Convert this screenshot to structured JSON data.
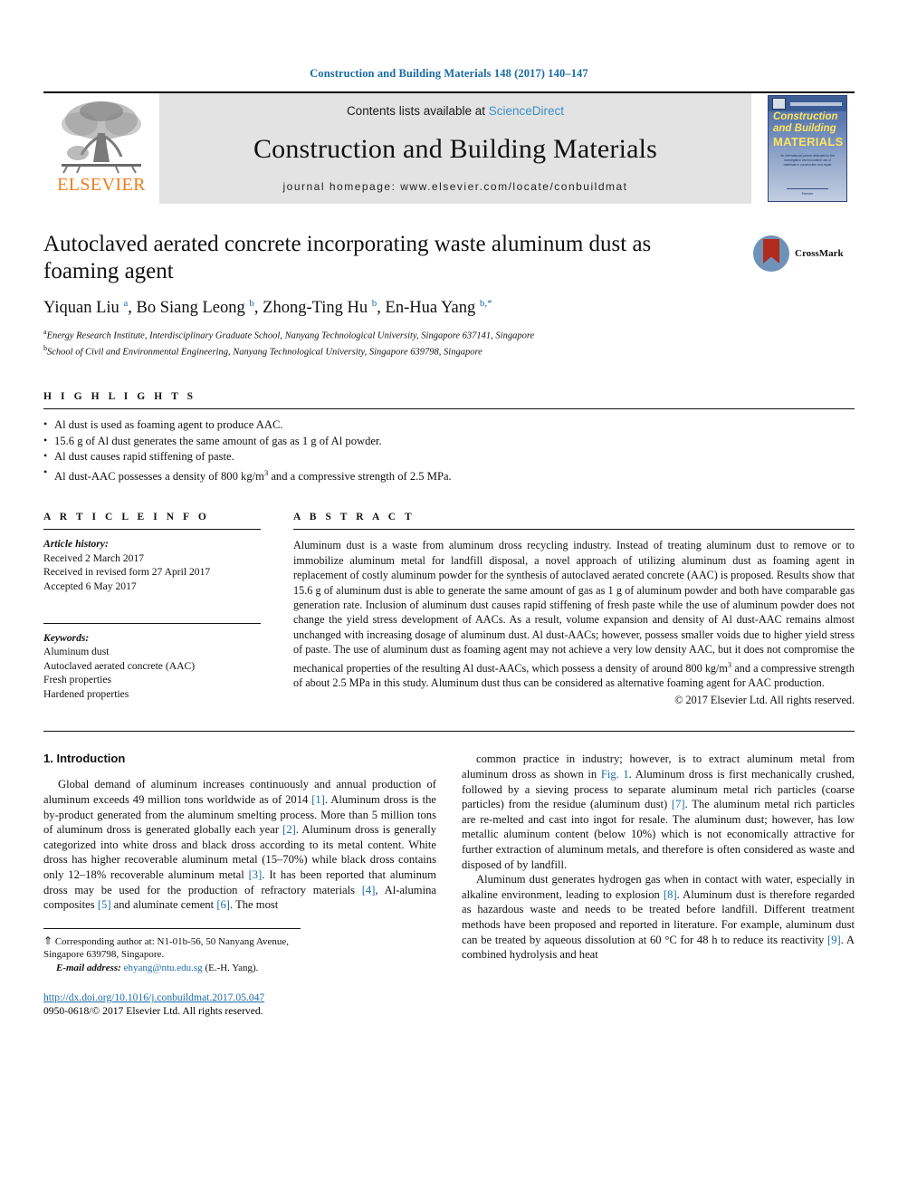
{
  "running_head": "Construction and Building Materials 148 (2017) 140–147",
  "masthead": {
    "elsevier_wordmark": "ELSEVIER",
    "contents_prefix": "Contents lists available at ",
    "contents_link": "ScienceDirect",
    "journal_title": "Construction and Building Materials",
    "homepage": "journal homepage: www.elsevier.com/locate/conbuildmat",
    "cover": {
      "line1": "Construction",
      "line2": "and Building",
      "line3": "MATERIALS",
      "blurb": "An international journal dedicated to the investigation and innovative use of materials in construction and repair",
      "footer": "Elsevier"
    }
  },
  "article": {
    "title": "Autoclaved aerated concrete incorporating waste aluminum dust as foaming agent",
    "crossmark_label": "CrossMark",
    "authors_html": "Yiquan Liu <sup>a</sup>, Bo Siang Leong <sup>b</sup>, Zhong-Ting Hu <sup>b</sup>, En-Hua Yang <sup>b,*</sup>",
    "affiliation_a": "Energy Research Institute, Interdisciplinary Graduate School, Nanyang Technological University, Singapore 637141, Singapore",
    "affiliation_b": "School of Civil and Environmental Engineering, Nanyang Technological University, Singapore 639798, Singapore"
  },
  "highlights": {
    "heading": "H I G H L I G H T S",
    "items_html": [
      "Al dust is used as foaming agent to produce AAC.",
      "15.6 g of Al dust generates the same amount of gas as 1 g of Al powder.",
      "Al dust causes rapid stiffening of paste.",
      "Al dust-AAC possesses a density of 800 kg/m<sup>3</sup> and a compressive strength of 2.5 MPa."
    ]
  },
  "article_info": {
    "heading": "A R T I C L E   I N F O",
    "history_label": "Article history:",
    "history": [
      "Received 2 March 2017",
      "Received in revised form 27 April 2017",
      "Accepted 6 May 2017"
    ],
    "keywords_label": "Keywords:",
    "keywords": [
      "Aluminum dust",
      "Autoclaved aerated concrete (AAC)",
      "Fresh properties",
      "Hardened properties"
    ]
  },
  "abstract": {
    "heading": "A B S T R A C T",
    "text_html": "Aluminum dust is a waste from aluminum dross recycling industry. Instead of treating aluminum dust to remove or to immobilize aluminum metal for landfill disposal, a novel approach of utilizing aluminum dust as foaming agent in replacement of costly aluminum powder for the synthesis of autoclaved aerated concrete (AAC) is proposed. Results show that 15.6 g of aluminum dust is able to generate the same amount of gas as 1 g of aluminum powder and both have comparable gas generation rate. Inclusion of aluminum dust causes rapid stiffening of fresh paste while the use of aluminum powder does not change the yield stress development of AACs. As a result, volume expansion and density of Al dust-AAC remains almost unchanged with increasing dosage of aluminum dust. Al dust-AACs; however, possess smaller voids due to higher yield stress of paste. The use of aluminum dust as foaming agent may not achieve a very low density AAC, but it does not compromise the mechanical properties of the resulting Al dust-AACs, which possess a density of around 800 kg/m<sup>3</sup> and a compressive strength of about 2.5 MPa in this study. Aluminum dust thus can be considered as alternative foaming agent for AAC production.",
    "copyright": "© 2017 Elsevier Ltd. All rights reserved."
  },
  "body": {
    "section_title": "1. Introduction",
    "left_paragraphs_html": [
      "Global demand of aluminum increases continuously and annual production of aluminum exceeds 49 million tons worldwide as of 2014 <span class=\"ref\">[1]</span>. Aluminum dross is the by-product generated from the aluminum smelting process. More than 5 million tons of aluminum dross is generated globally each year <span class=\"ref\">[2]</span>. Aluminum dross is generally categorized into white dross and black dross according to its metal content. White dross has higher recoverable aluminum metal (15–70%) while black dross contains only 12–18% recoverable aluminum metal <span class=\"ref\">[3]</span>. It has been reported that aluminum dross may be used for the production of refractory materials <span class=\"ref\">[4]</span>, Al-alumina composites <span class=\"ref\">[5]</span> and aluminate cement <span class=\"ref\">[6]</span>. The most"
    ],
    "right_paragraphs_html": [
      "common practice in industry; however, is to extract aluminum metal from aluminum dross as shown in <span class=\"ref\">Fig. 1</span>. Aluminum dross is first mechanically crushed, followed by a sieving process to separate aluminum metal rich particles (coarse particles) from the residue (aluminum dust) <span class=\"ref\">[7]</span>. The aluminum metal rich particles are re-melted and cast into ingot for resale. The aluminum dust; however, has low metallic aluminum content (below 10%) which is not economically attractive for further extraction of aluminum metals, and therefore is often considered as waste and disposed of by landfill.",
      "Aluminum dust generates hydrogen gas when in contact with water, especially in alkaline environment, leading to explosion <span class=\"ref\">[8]</span>. Aluminum dust is therefore regarded as hazardous waste and needs to be treated before landfill. Different treatment methods have been proposed and reported in literature. For example, aluminum dust can be treated by aqueous dissolution at 60 °C for 48 h to reduce its reactivity <span class=\"ref\">[9]</span>. A combined hydrolysis and heat"
    ]
  },
  "footnote": {
    "corresponding_html": "<span style=\"font-size:12px\">⇑</span> Corresponding author at: N1-01b-56, 50 Nanyang Avenue, Singapore 639798, Singapore.",
    "email_label": "E-mail address:",
    "email": "ehyang@ntu.edu.sg",
    "email_owner": "(E.-H. Yang)."
  },
  "footer": {
    "doi": "http://dx.doi.org/10.1016/j.conbuildmat.2017.05.047",
    "issn_line": "0950-0618/© 2017 Elsevier Ltd. All rights reserved."
  },
  "colors": {
    "link_blue": "#1a6ba5",
    "elsevier_orange": "#ef7d1a",
    "masthead_grey": "#e3e3e3",
    "cover_yellow": "#ffe45c",
    "crossmark_red": "#b02a1e"
  }
}
